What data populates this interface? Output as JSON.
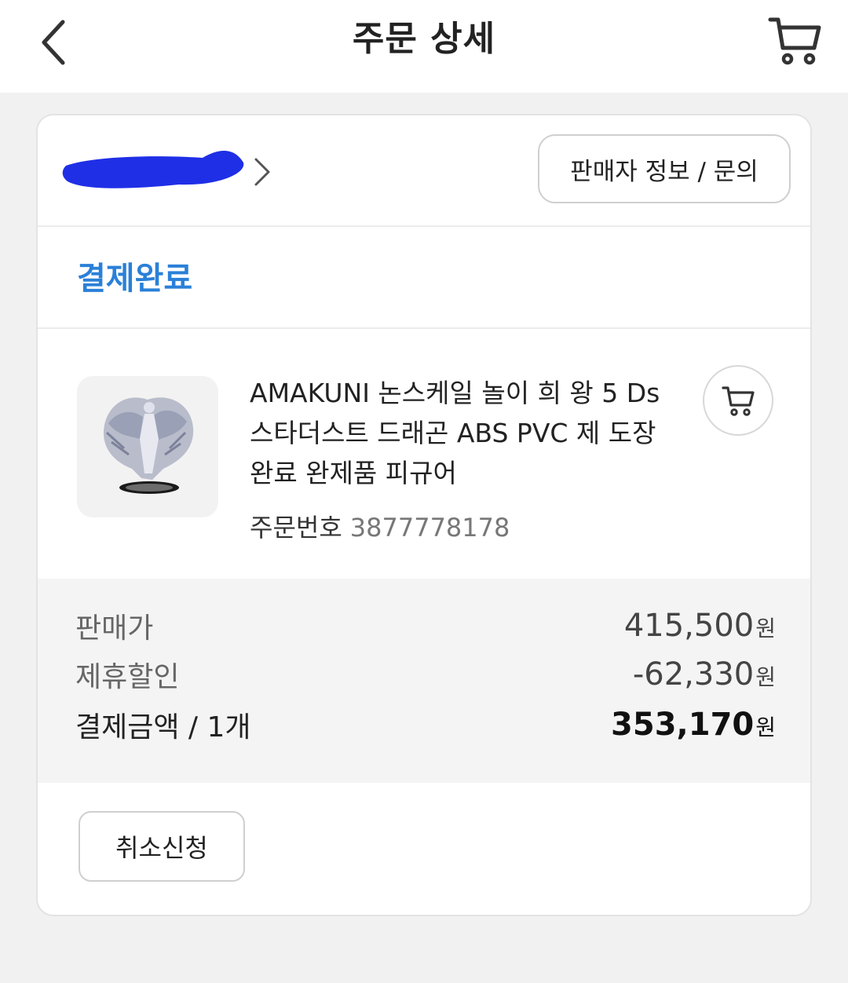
{
  "header": {
    "title": "주문 상세",
    "back_icon": "chevron-left-icon",
    "cart_icon": "cart-icon"
  },
  "seller": {
    "name": "",
    "info_button_label": "판매자 정보 / 문의"
  },
  "order_status": {
    "label": "결제완료",
    "color": "#2a80d8"
  },
  "product": {
    "title": "AMAKUNI 논스케일 놀이 희 왕 5 Ds 스타더스트 드래곤 ABS PVC 제 도장 완료 완제품 피규어",
    "order_number_label": "주문번호",
    "order_number": "3877778178"
  },
  "prices": {
    "sale_price_label": "판매가",
    "sale_price": "415,500",
    "discount_label": "제휴할인",
    "discount": "-62,330",
    "total_label": "결제금액 / 1개",
    "total": "353,170",
    "currency_unit": "원"
  },
  "actions": {
    "cancel_label": "취소신청"
  }
}
